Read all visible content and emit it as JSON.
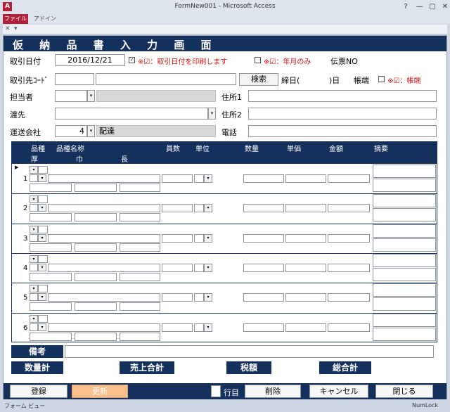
{
  "window": {
    "title": "FormNew001  -  Microsoft Access",
    "app_icon": "A",
    "controls": [
      "?",
      "—",
      "▢",
      "✕"
    ]
  },
  "ribbon": {
    "tab_file": "ファイル",
    "tab_addin": "アドイン"
  },
  "form": {
    "title": "仮 納 品 書 入 力 画 面",
    "torihiki_date_label": "取引日付",
    "torihiki_date_value": "2016/12/21",
    "print_date_note": "※☑：取引日付を印刷します",
    "year_month_note": "※☑：年月のみ",
    "denpyo_label": "伝票NO",
    "torihikisaki_label": "取引先ｺｰﾄﾞ",
    "search_button": "検索",
    "shimebi_label": "締日(",
    "shimebi_suffix": ")日",
    "hata_label": "帳端",
    "hata_note": "※☑：帳端",
    "tanto_label": "担当者",
    "jusho1_label": "住所1",
    "watashisaki_label": "渡先",
    "jusho2_label": "住所2",
    "unso_label": "運送会社",
    "unso_value": "4",
    "unso_name": "配達",
    "denwa_label": "電話"
  },
  "grid": {
    "headers": {
      "hinshu": "品種",
      "hinshu_name": "品種名称",
      "kazu": "員数",
      "tani": "単位",
      "suryo": "数量",
      "tanka": "単価",
      "kingaku": "金額",
      "tekiyo": "摘要",
      "atsu": "厚",
      "haba": "巾",
      "naga": "長"
    },
    "row_numbers": [
      "1",
      "2",
      "3",
      "4",
      "5",
      "6"
    ]
  },
  "bottom": {
    "biko_label": "備考",
    "suryo_total": "数量計",
    "uriage_total": "売上合計",
    "zeigaku": "税額",
    "sogokei": "総合計"
  },
  "footer": {
    "toroku": "登録",
    "koshin": "更新",
    "gyome": "行目",
    "sakujo": "削除",
    "cancel": "キャンセル",
    "tojiru": "閉じる"
  },
  "status": {
    "view": "フォーム ビュー",
    "numlock": "NumLock"
  },
  "colors": {
    "navy": "#14305c",
    "accent_red": "#b0213a",
    "update_button": "#f9c08e"
  }
}
